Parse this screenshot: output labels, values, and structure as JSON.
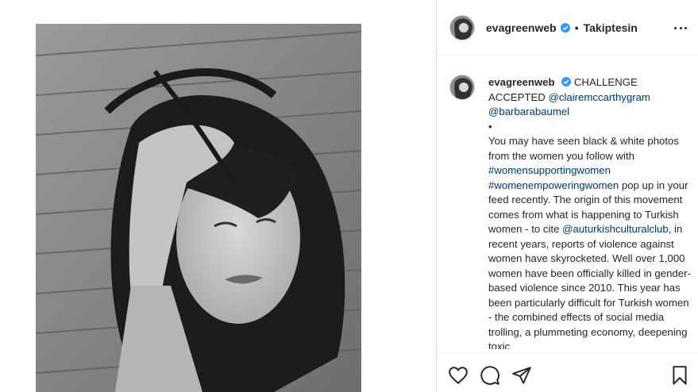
{
  "post": {
    "username": "evagreenweb",
    "follow_status": "Takiptesin",
    "bullet": "•",
    "photo_alt": "Black and white selfie"
  },
  "caption": {
    "username": "evagreenweb",
    "p1_text": "CHALLENGE ACCEPTED",
    "mention1": "@clairemccarthygram",
    "mention2": "@barbarabaumel",
    "dot": "•",
    "p2a": "You may have seen black & white photos from the women you follow with",
    "hashtag1": "#womensupportingwomen",
    "hashtag2": "#womenempoweringwomen",
    "p2b": "pop up in your feed recently. The origin of this movement comes from what is happening to Turkish women - to cite",
    "mention3": "@auturkishculturalclub",
    "p2c": ", in recent years, reports of violence against women have skyrocketed. Well over 1,000 women have been officially killed in gender-based violence since 2010. This year has been particularly difficult for Turkish women - the combined effects of social media trolling, a plummeting economy, deepening toxic"
  },
  "icons": {
    "more": "more-options-icon",
    "like": "heart-icon",
    "comment": "comment-icon",
    "share": "direct-share-icon",
    "save": "bookmark-icon",
    "verified": "verified-badge-icon"
  },
  "colors": {
    "verified": "#3897f0",
    "link": "#00376b",
    "text": "#262626",
    "border": "#dbdbdb"
  }
}
